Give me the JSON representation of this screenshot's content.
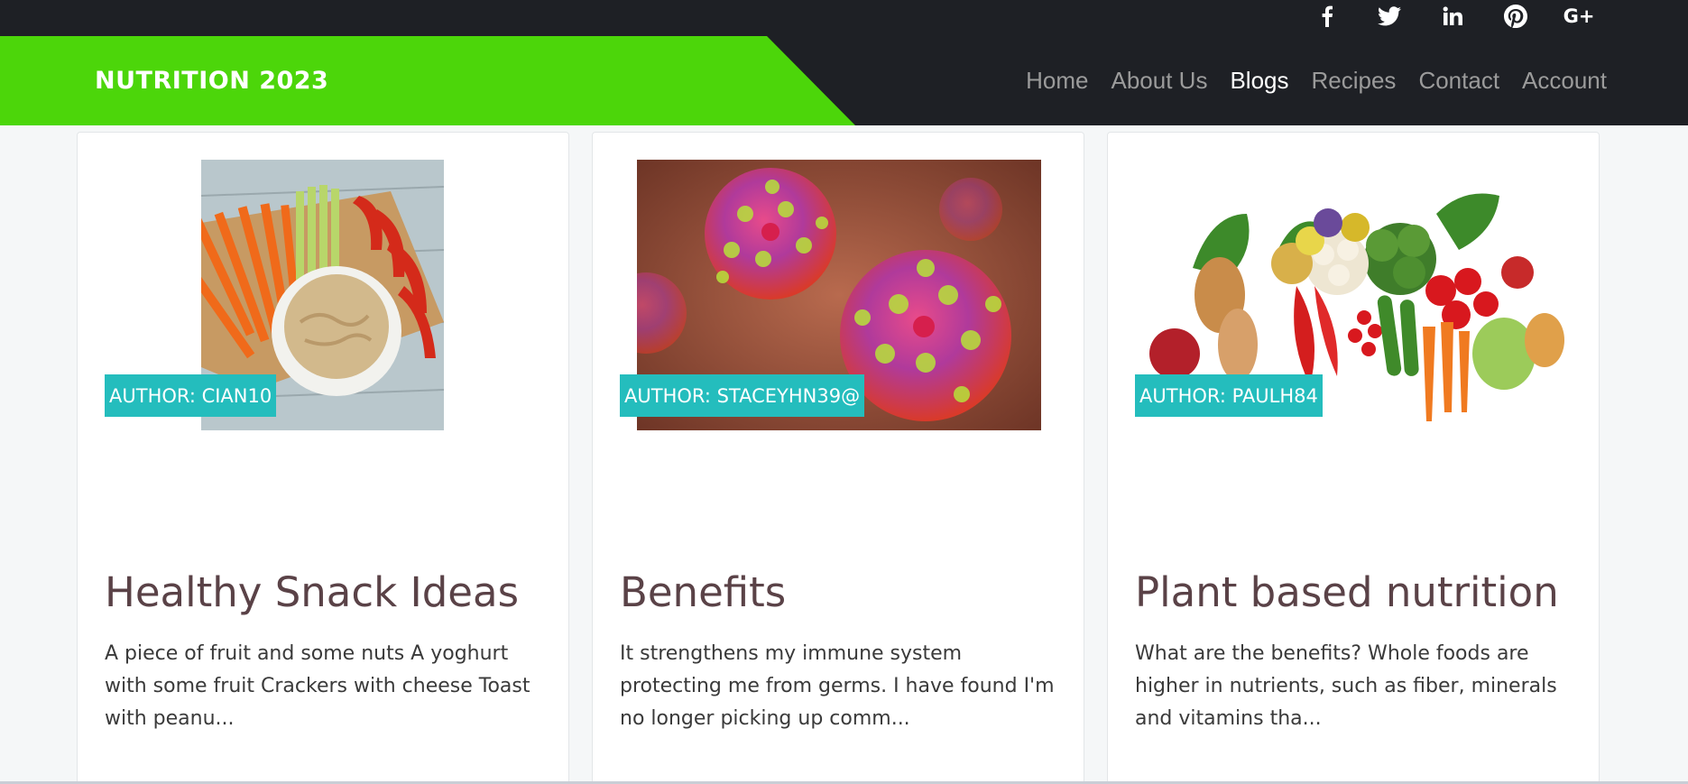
{
  "social": {
    "items": [
      {
        "name": "facebook-icon",
        "glyph": "f"
      },
      {
        "name": "twitter-icon",
        "glyph": ""
      },
      {
        "name": "linkedin-icon",
        "glyph": "in"
      },
      {
        "name": "pinterest-icon",
        "glyph": ""
      },
      {
        "name": "google-plus-icon",
        "glyph": "G+"
      }
    ]
  },
  "navbar": {
    "brand": "NUTRITION 2023",
    "brand_color": "#4cd60a",
    "links": [
      "Home",
      "About Us",
      "Blogs",
      "Recipes",
      "Contact",
      "Account"
    ],
    "active": "Blogs"
  },
  "cards": [
    {
      "author": "AUTHOR: CIAN10",
      "title": "Healthy Snack Ideas",
      "excerpt": "A piece of fruit and some nuts A yoghurt with some fruit Crackers with cheese Toast with peanu...",
      "image": "veggie-sticks-hummus-image"
    },
    {
      "author": "AUTHOR: STACEYHN39@",
      "title": "Benefits",
      "excerpt": "It strengthens my immune system protecting me from germs. I have found I'm no longer picking up comm...",
      "image": "virus-particles-image"
    },
    {
      "author": "AUTHOR: PAULH84",
      "title": "Plant based nutrition",
      "excerpt": "What are the benefits? Whole foods are higher in nutrients, such as fiber, minerals and vitamins tha...",
      "image": "fruits-vegetables-image"
    }
  ],
  "colors": {
    "dark": "#1e2025",
    "accent_green": "#4cd60a",
    "badge_teal": "#24bdbd",
    "title_brown": "#5a4247"
  }
}
